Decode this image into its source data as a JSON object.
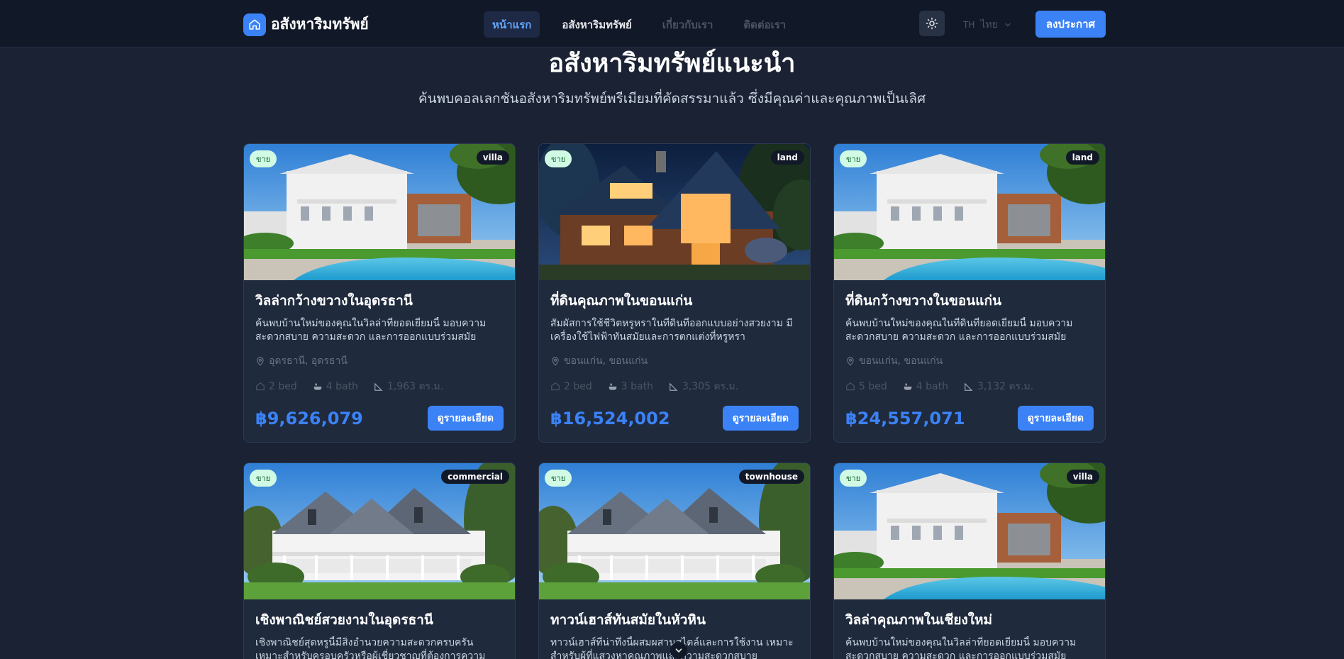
{
  "nav": {
    "brand": "อสังหาริมทรัพย์",
    "links": [
      {
        "label": "หน้าแรก",
        "state": "active"
      },
      {
        "label": "อสังหาริมทรัพย์",
        "state": "normal"
      },
      {
        "label": "เกี่ยวกับเรา",
        "state": "muted"
      },
      {
        "label": "ติดต่อเรา",
        "state": "muted"
      }
    ],
    "lang_code": "TH",
    "lang_name": "ไทย",
    "post_button": "ลงประกาศ"
  },
  "section": {
    "title": "อสังหาริมทรัพย์แนะนำ",
    "subtitle": "ค้นพบคอลเลกชันอสังหาริมทรัพย์พรีเมียมที่คัดสรรมาแล้ว ซึ่งมีคุณค่าและคุณภาพเป็นเลิศ"
  },
  "cards": [
    {
      "sale_badge": "ขาย",
      "type": "villa",
      "photo": "villa-pool",
      "title": "วิลล่ากว้างขวางในอุดรธานี",
      "desc": "ค้นพบบ้านใหม่ของคุณในวิลล่าที่ยอดเยี่ยมนี้ มอบความสะดวกสบาย ความสะดวก และการออกแบบร่วมสมัย",
      "location": "อุดรธานี, อุดรธานี",
      "bed": "2 bed",
      "bath": "4 bath",
      "area": "1,963 ตร.ม.",
      "price": "฿9,626,079",
      "button": "ดูรายละเอียด"
    },
    {
      "sale_badge": "ขาย",
      "type": "land",
      "photo": "cabin-night",
      "title": "ที่ดินคุณภาพในขอนแก่น",
      "desc": "สัมผัสการใช้ชีวิตหรูหราในที่ดินที่ออกแบบอย่างสวยงาม มีเครื่องใช้ไฟฟ้าทันสมัยและการตกแต่งที่หรูหรา",
      "location": "ขอนแก่น, ขอนแก่น",
      "bed": "2 bed",
      "bath": "3 bath",
      "area": "3,305 ตร.ม.",
      "price": "฿16,524,002",
      "button": "ดูรายละเอียด"
    },
    {
      "sale_badge": "ขาย",
      "type": "land",
      "photo": "villa-pool",
      "title": "ที่ดินกว้างขวางในขอนแก่น",
      "desc": "ค้นพบบ้านใหม่ของคุณในที่ดินที่ยอดเยี่ยมนี้ มอบความสะดวกสบาย ความสะดวก และการออกแบบร่วมสมัย",
      "location": "ขอนแก่น, ขอนแก่น",
      "bed": "5 bed",
      "bath": "4 bath",
      "area": "3,132 ตร.ม.",
      "price": "฿24,557,071",
      "button": "ดูรายละเอียด"
    },
    {
      "sale_badge": "ขาย",
      "type": "commercial",
      "photo": "colonial-house",
      "title": "เชิงพาณิชย์สวยงามในอุดรธานี",
      "desc": "เชิงพาณิชย์สุดหรูนี้มีสิ่งอำนวยความสะดวกครบครัน เหมาะสำหรับครอบครัวหรือผู้เชี่ยวชาญที่ต้องการความสะดวกสบาย",
      "photo_only": true
    },
    {
      "sale_badge": "ขาย",
      "type": "townhouse",
      "photo": "colonial-house",
      "title": "ทาวน์เฮาส์ทันสมัยในหัวหิน",
      "desc": "ทาวน์เฮาส์ที่น่าทึ่งนี้ผสมผสานสไตล์และการใช้งาน เหมาะสำหรับผู้ที่แสวงหาคุณภาพและความสะดวกสบาย"
    },
    {
      "sale_badge": "ขาย",
      "type": "villa",
      "photo": "villa-pool",
      "title": "วิลล่าคุณภาพในเชียงใหม่",
      "desc": "ค้นพบบ้านใหม่ของคุณในวิลล่าที่ยอดเยี่ยมนี้ มอบความสะดวกสบาย ความสะดวก และการออกแบบร่วมสมัย"
    }
  ],
  "colors": {
    "accent": "#3b82f6",
    "background": "#1a2233",
    "card": "#1f2a3d",
    "navbar": "#111827"
  },
  "icons": [
    "home-icon",
    "sun-icon",
    "chevron-down-icon",
    "map-pin-icon",
    "bed-icon",
    "bath-icon",
    "ruler-icon"
  ]
}
